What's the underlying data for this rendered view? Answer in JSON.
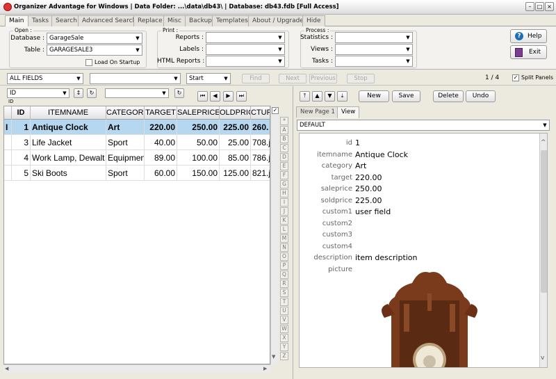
{
  "window": {
    "title": "Organizer Advantage for Windows | Data Folder: ...\\data\\db43\\ | Database: db43.fdb [Full Access]"
  },
  "tabs": [
    "Main",
    "Tasks",
    "Search",
    "Advanced Search",
    "Replace",
    "Misc",
    "Backup",
    "Templates",
    "About / Upgrade",
    "Hide"
  ],
  "open_group": {
    "label": "Open :",
    "database_label": "Database :",
    "database_value": "GarageSale",
    "table_label": "Table :",
    "table_value": "GARAGESALE3",
    "load_on_startup": "Load On Startup"
  },
  "print_group": {
    "label": "Print :",
    "reports": "Reports :",
    "labels": "Labels :",
    "html_reports": "HTML Reports :"
  },
  "process_group": {
    "label": "Process :",
    "statistics": "Statistics :",
    "views": "Views :",
    "tasks": "Tasks :"
  },
  "help_button": "Help",
  "exit_button": "Exit",
  "search_bar": {
    "field": "ALL FIELDS",
    "value": "",
    "mode": "Start",
    "find": "Find",
    "next": "Next",
    "previous": "Previous",
    "stop": "Stop",
    "record_pos": "1 / 4",
    "split_panels": "Split Panels"
  },
  "sort": {
    "field": "ID",
    "sub": "ID"
  },
  "columns": [
    "ID",
    "ITEMNAME",
    "CATEGORY",
    "TARGET",
    "SALEPRICE",
    "SOLDPRICE",
    "PICTURE"
  ],
  "columns_visible": [
    "ID",
    "ITEMNAME",
    "CATEGORY",
    "TARGET",
    "SALEPRICE",
    "OLDPRIC",
    "CTUR"
  ],
  "rows": [
    {
      "marker": "I",
      "id": "1",
      "itemname": "Antique Clock",
      "category": "Art",
      "target": "220.00",
      "saleprice": "250.00",
      "soldprice": "225.00",
      "picture": "260."
    },
    {
      "marker": "",
      "id": "3",
      "itemname": "Life Jacket",
      "category": "Sport",
      "target": "40.00",
      "saleprice": "50.00",
      "soldprice": "25.00",
      "picture": "708.j"
    },
    {
      "marker": "",
      "id": "4",
      "itemname": "Work Lamp, Dewalt",
      "category": "Equipment",
      "target": "89.00",
      "saleprice": "100.00",
      "soldprice": "85.00",
      "picture": "786.j"
    },
    {
      "marker": "",
      "id": "5",
      "itemname": "Ski Boots",
      "category": "Sport",
      "target": "60.00",
      "saleprice": "150.00",
      "soldprice": "125.00",
      "picture": "821.j"
    }
  ],
  "alphabet": [
    "*",
    "A",
    "B",
    "C",
    "D",
    "E",
    "F",
    "G",
    "H",
    "I",
    "J",
    "K",
    "L",
    "M",
    "N",
    "O",
    "P",
    "Q",
    "R",
    "S",
    "T",
    "U",
    "V",
    "W",
    "X",
    "Y",
    "Z"
  ],
  "record_buttons": {
    "new": "New",
    "save": "Save",
    "delete": "Delete",
    "undo": "Undo"
  },
  "record_tabs": [
    "New Page 1",
    "View"
  ],
  "view_select": "DEFAULT",
  "record_fields": [
    {
      "label": "id",
      "value": "1"
    },
    {
      "label": "itemname",
      "value": "Antique Clock"
    },
    {
      "label": "category",
      "value": "Art"
    },
    {
      "label": "target",
      "value": "220.00"
    },
    {
      "label": "saleprice",
      "value": "250.00"
    },
    {
      "label": "soldprice",
      "value": "225.00"
    },
    {
      "label": "custom1",
      "value": "user field"
    },
    {
      "label": "custom2",
      "value": ""
    },
    {
      "label": "custom3",
      "value": ""
    },
    {
      "label": "custom4",
      "value": ""
    },
    {
      "label": "description",
      "value": "item description"
    },
    {
      "label": "picture",
      "value": ""
    }
  ],
  "colors": {
    "selected_row": "#b5d8f0",
    "accent": "#1a6fb4"
  }
}
